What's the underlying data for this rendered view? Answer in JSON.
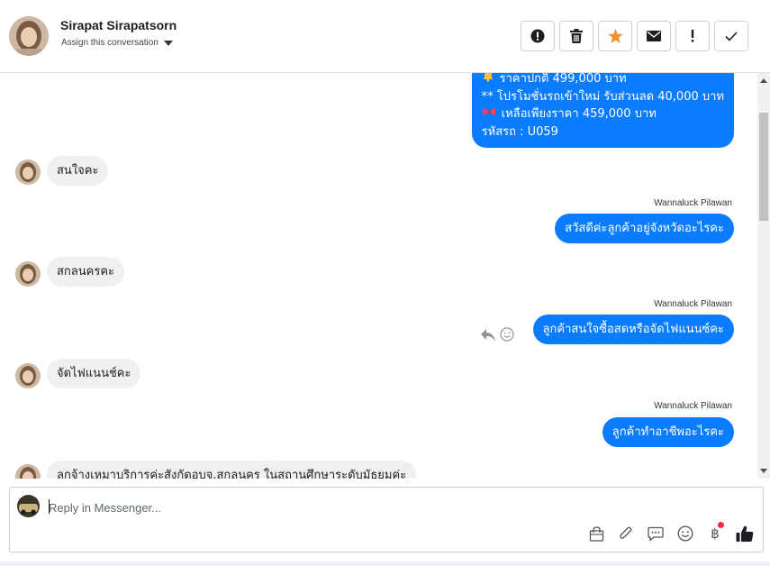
{
  "header": {
    "contact_name": "Sirapat Sirapatsorn",
    "assign_label": "Assign this conversation",
    "actions": [
      {
        "name": "mark-spam",
        "icon": "alert-circle-icon"
      },
      {
        "name": "delete",
        "icon": "trash-icon"
      },
      {
        "name": "star",
        "icon": "star-icon"
      },
      {
        "name": "mark-unread",
        "icon": "envelope-icon"
      },
      {
        "name": "important",
        "icon": "exclamation-icon"
      },
      {
        "name": "done",
        "icon": "checkmark-icon"
      }
    ]
  },
  "conversation": {
    "product_message": {
      "lines": [
        {
          "icon": "bell",
          "text": "ราคาปกติ 499,000 บาท"
        },
        {
          "icon": "",
          "text": "** โปรโมชั่นรถเข้าใหม่ รับส่วนลด 40,000 บาท"
        },
        {
          "icon": "ribbon",
          "text": " เหลือเพียงราคา 459,000 บาท"
        },
        {
          "icon": "",
          "text": "รหัสรถ : U059"
        }
      ]
    },
    "messages": [
      {
        "direction": "in",
        "text": "สนใจคะ"
      },
      {
        "direction": "out",
        "sender": "Wannaluck Pilawan",
        "text": "สวัสดีค่ะลูกค้าอยู่จังหวัดอะไรคะ"
      },
      {
        "direction": "in",
        "text": "สกลนครคะ"
      },
      {
        "direction": "out",
        "sender": "Wannaluck Pilawan",
        "text": "ลูกค้าสนใจซื้อสดหรือจัดไฟแนนซ์คะ"
      },
      {
        "direction": "in",
        "text": "จัดไฟแนนช์คะ"
      },
      {
        "direction": "out",
        "sender": "Wannaluck Pilawan",
        "text": "ลูกค้าทำอาชีพอะไรคะ"
      },
      {
        "direction": "in",
        "text": "ลูกจ้างเหมาบริการค่ะสังกัดอบจ.สกลนคร ในสถานศึกษาระดับมัธยมค่ะ"
      }
    ]
  },
  "composer": {
    "placeholder": "Reply in Messenger...",
    "tools": [
      "shopping-bag-icon",
      "paperclip-icon",
      "saved-reply-icon",
      "emoji-icon",
      "baht-payment-icon",
      "thumbs-up-icon"
    ],
    "baht_symbol": "฿"
  },
  "colors": {
    "accent": "#0a7cff",
    "incoming_bubble": "#f0f0f0",
    "star": "#f0922b",
    "badge": "#f02849"
  }
}
